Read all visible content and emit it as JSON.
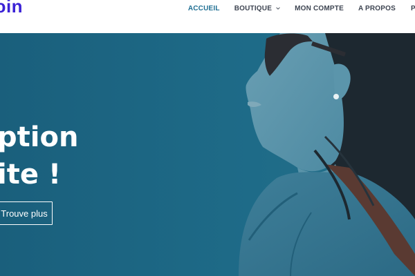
{
  "header": {
    "logo_text": "ɔin",
    "nav": [
      {
        "label": "ACCUEIL",
        "active": true
      },
      {
        "label": "BOUTIQUE",
        "has_dropdown": true
      },
      {
        "label": "MON COMPTE"
      },
      {
        "label": "A PROPOS"
      },
      {
        "label": "P"
      }
    ]
  },
  "hero": {
    "title_line1": "ption",
    "title_line2": "ite !",
    "cta_label": "Trouve plus"
  },
  "colors": {
    "brand": "#3b22d6",
    "nav_active": "#1f6f93",
    "hero_background": "#1e6b88"
  }
}
